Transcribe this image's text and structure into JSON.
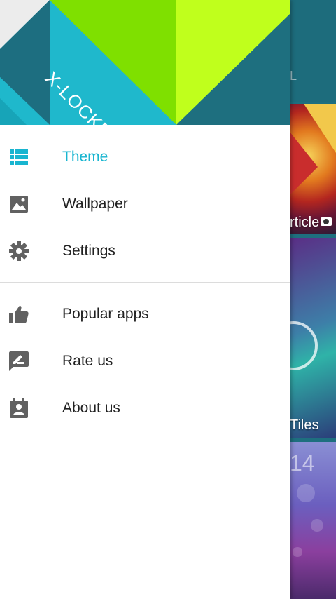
{
  "header": {
    "logo_text": "X-LOCKER"
  },
  "menu": {
    "primary": [
      {
        "label": "Theme",
        "icon": "list-icon",
        "active": true
      },
      {
        "label": "Wallpaper",
        "icon": "image-icon",
        "active": false
      },
      {
        "label": "Settings",
        "icon": "gear-icon",
        "active": false
      }
    ],
    "secondary": [
      {
        "label": "Popular apps",
        "icon": "thumbs-up-icon"
      },
      {
        "label": "Rate us",
        "icon": "rate-feedback-icon"
      },
      {
        "label": "About us",
        "icon": "contact-card-icon"
      }
    ]
  },
  "background": {
    "tiles": [
      {
        "label": "rticle"
      },
      {
        "label": "Tiles"
      },
      {
        "label": "14"
      }
    ]
  },
  "colors": {
    "accent": "#18b5d0",
    "icon": "#616161",
    "text": "#212121"
  }
}
